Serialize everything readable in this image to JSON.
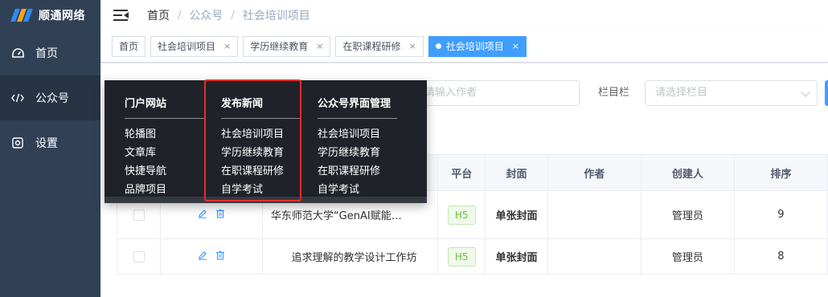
{
  "brand": {
    "name": "顺通网络"
  },
  "sidebar": {
    "items": [
      {
        "label": "首页",
        "icon": "dashboard-icon"
      },
      {
        "label": "公众号",
        "icon": "code-icon"
      },
      {
        "label": "设置",
        "icon": "settings-icon"
      }
    ]
  },
  "breadcrumb": {
    "items": [
      "首页",
      "公众号",
      "社会培训项目"
    ],
    "separator": "/"
  },
  "tags": [
    {
      "label": "首页",
      "closable": false
    },
    {
      "label": "社会培训项目",
      "closable": true
    },
    {
      "label": "学历继续教育",
      "closable": true
    },
    {
      "label": "在职课程研修",
      "closable": true
    },
    {
      "label": "社会培训项目",
      "closable": true,
      "active": true
    }
  ],
  "tag_close": "×",
  "filters": {
    "author_placeholder": "请输入作者",
    "column_label": "栏目栏",
    "column_placeholder": "请选择栏目"
  },
  "table": {
    "headers": [
      "",
      "",
      "",
      "平台",
      "封面",
      "作者",
      "创建人",
      "排序"
    ],
    "rows": [
      {
        "title": "华东师范大学“GenAI赋能…",
        "platform": "H5",
        "cover": "单张封面",
        "author": "",
        "creator": "管理员",
        "sort": "9"
      },
      {
        "title": "追求理解的教学设计工作坊",
        "platform": "H5",
        "cover": "单张封面",
        "author": "",
        "creator": "管理员",
        "sort": "8"
      }
    ]
  },
  "mega_menu": {
    "columns": [
      {
        "title": "门户网站",
        "items": [
          "轮播图",
          "文章库",
          "快捷导航",
          "品牌项目"
        ]
      },
      {
        "title": "发布新闻",
        "items": [
          "社会培训项目",
          "学历继续教育",
          "在职课程研修",
          "自学考试"
        ]
      },
      {
        "title": "公众号界面管理",
        "items": [
          "社会培训项目",
          "学历继续教育",
          "在职课程研修",
          "自学考试"
        ]
      }
    ]
  },
  "colors": {
    "sidebar": "#304156",
    "accent": "#409eff",
    "highlight": "#e62b2b",
    "menu_bg": "#1f2329"
  }
}
